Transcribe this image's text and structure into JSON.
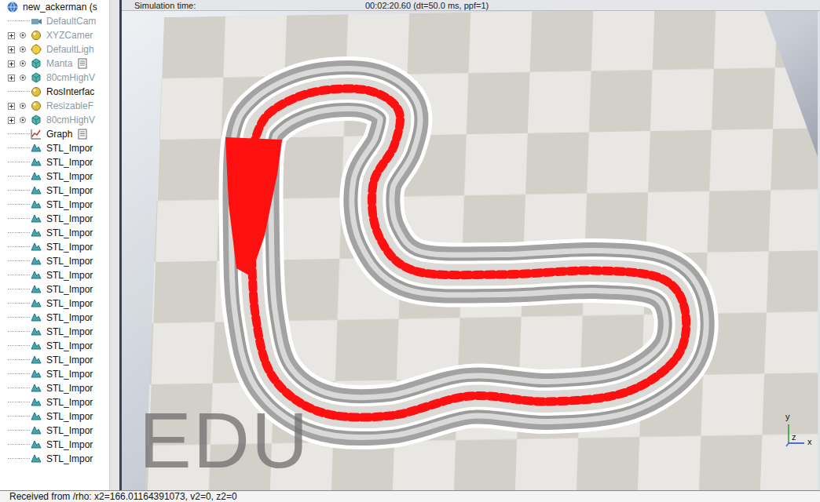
{
  "scene_tree": {
    "items": [
      {
        "label": "new_ackerman (s",
        "kind": "world",
        "expandable": false,
        "visible_toggle": false,
        "dimmed": false,
        "script": false
      },
      {
        "label": "DefaultCam",
        "kind": "camera",
        "expandable": false,
        "visible_toggle": false,
        "dimmed": true,
        "script": false
      },
      {
        "label": "XYZCamer",
        "kind": "dummy",
        "expandable": true,
        "visible_toggle": true,
        "dimmed": true,
        "script": false
      },
      {
        "label": "DefaultLigh",
        "kind": "light",
        "expandable": true,
        "visible_toggle": true,
        "dimmed": true,
        "script": false
      },
      {
        "label": "Manta",
        "kind": "shape",
        "expandable": true,
        "visible_toggle": true,
        "dimmed": true,
        "script": true
      },
      {
        "label": "80cmHighV",
        "kind": "shape",
        "expandable": true,
        "visible_toggle": true,
        "dimmed": true,
        "script": false
      },
      {
        "label": "RosInterfac",
        "kind": "dummy",
        "expandable": false,
        "visible_toggle": false,
        "dimmed": false,
        "script": false
      },
      {
        "label": "ResizableF",
        "kind": "dummy",
        "expandable": true,
        "visible_toggle": true,
        "dimmed": true,
        "script": false
      },
      {
        "label": "80cmHighV",
        "kind": "shape",
        "expandable": true,
        "visible_toggle": true,
        "dimmed": true,
        "script": false
      },
      {
        "label": "Graph",
        "kind": "graph",
        "expandable": false,
        "visible_toggle": false,
        "dimmed": false,
        "script": true
      },
      {
        "label": "STL_Impor",
        "kind": "mesh",
        "expandable": false,
        "visible_toggle": false,
        "dimmed": false,
        "script": false
      },
      {
        "label": "STL_Impor",
        "kind": "mesh",
        "expandable": false,
        "visible_toggle": false,
        "dimmed": false,
        "script": false
      },
      {
        "label": "STL_Impor",
        "kind": "mesh",
        "expandable": false,
        "visible_toggle": false,
        "dimmed": false,
        "script": false
      },
      {
        "label": "STL_Impor",
        "kind": "mesh",
        "expandable": false,
        "visible_toggle": false,
        "dimmed": false,
        "script": false
      },
      {
        "label": "STL_Impor",
        "kind": "mesh",
        "expandable": false,
        "visible_toggle": false,
        "dimmed": false,
        "script": false
      },
      {
        "label": "STL_Impor",
        "kind": "mesh",
        "expandable": false,
        "visible_toggle": false,
        "dimmed": false,
        "script": false
      },
      {
        "label": "STL_Impor",
        "kind": "mesh",
        "expandable": false,
        "visible_toggle": false,
        "dimmed": false,
        "script": false
      },
      {
        "label": "STL_Impor",
        "kind": "mesh",
        "expandable": false,
        "visible_toggle": false,
        "dimmed": false,
        "script": false
      },
      {
        "label": "STL_Impor",
        "kind": "mesh",
        "expandable": false,
        "visible_toggle": false,
        "dimmed": false,
        "script": false
      },
      {
        "label": "STL_Impor",
        "kind": "mesh",
        "expandable": false,
        "visible_toggle": false,
        "dimmed": false,
        "script": false
      },
      {
        "label": "STL_Impor",
        "kind": "mesh",
        "expandable": false,
        "visible_toggle": false,
        "dimmed": false,
        "script": false
      },
      {
        "label": "STL_Impor",
        "kind": "mesh",
        "expandable": false,
        "visible_toggle": false,
        "dimmed": false,
        "script": false
      },
      {
        "label": "STL_Impor",
        "kind": "mesh",
        "expandable": false,
        "visible_toggle": false,
        "dimmed": false,
        "script": false
      },
      {
        "label": "STL_Impor",
        "kind": "mesh",
        "expandable": false,
        "visible_toggle": false,
        "dimmed": false,
        "script": false
      },
      {
        "label": "STL_Impor",
        "kind": "mesh",
        "expandable": false,
        "visible_toggle": false,
        "dimmed": false,
        "script": false
      },
      {
        "label": "STL_Impor",
        "kind": "mesh",
        "expandable": false,
        "visible_toggle": false,
        "dimmed": false,
        "script": false
      },
      {
        "label": "STL_Impor",
        "kind": "mesh",
        "expandable": false,
        "visible_toggle": false,
        "dimmed": false,
        "script": false
      },
      {
        "label": "STL_Impor",
        "kind": "mesh",
        "expandable": false,
        "visible_toggle": false,
        "dimmed": false,
        "script": false
      },
      {
        "label": "STL_Impor",
        "kind": "mesh",
        "expandable": false,
        "visible_toggle": false,
        "dimmed": false,
        "script": false
      },
      {
        "label": "STL_Impor",
        "kind": "mesh",
        "expandable": false,
        "visible_toggle": false,
        "dimmed": false,
        "script": false
      },
      {
        "label": "STL_Impor",
        "kind": "mesh",
        "expandable": false,
        "visible_toggle": false,
        "dimmed": false,
        "script": false
      },
      {
        "label": "STL_Impor",
        "kind": "mesh",
        "expandable": false,
        "visible_toggle": false,
        "dimmed": false,
        "script": false
      },
      {
        "label": "STL_Impor",
        "kind": "mesh",
        "expandable": false,
        "visible_toggle": false,
        "dimmed": false,
        "script": false
      }
    ]
  },
  "view": {
    "sim_label": "Simulation time:",
    "sim_time": "00:02:20.60 (dt=50.0 ms, ppf=1)",
    "watermark": "EDU",
    "axes": {
      "x": "x",
      "y": "y",
      "z": "z"
    }
  },
  "status_bar": {
    "text": "Received from /rho: x2=166.01164391073, v2=0, z2=0"
  }
}
